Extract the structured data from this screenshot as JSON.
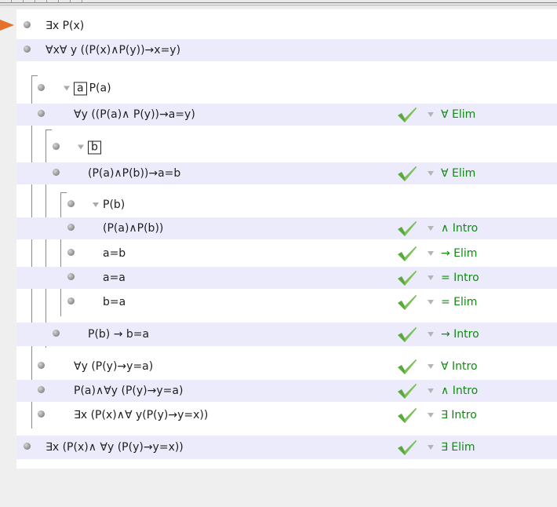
{
  "proof": {
    "premises": [
      "∃x P(x)",
      "∀x∀ y ((P(x)∧P(y))→x=y)"
    ],
    "outer_box": {
      "var": "a",
      "assumption": "P(a)",
      "step1": {
        "formula": "∀y ((P(a)∧ P(y))→a=y)",
        "rule": "∀ Elim"
      },
      "inner_box": {
        "var": "b",
        "step1": {
          "formula": "(P(a)∧P(b))→a=b",
          "rule": "∀ Elim"
        },
        "sub_box": {
          "assumption": "P(b)",
          "lines": [
            {
              "formula": "(P(a)∧P(b))",
              "rule": "∧ Intro"
            },
            {
              "formula": "a=b",
              "rule": "→ Elim"
            },
            {
              "formula": "a=a",
              "rule": "= Intro"
            },
            {
              "formula": "b=a",
              "rule": "= Elim"
            }
          ]
        },
        "conclusion": {
          "formula": "P(b) → b=a",
          "rule": "→ Intro"
        }
      },
      "after": [
        {
          "formula": "∀y (P(y)→y=a)",
          "rule": "∀ Intro"
        },
        {
          "formula": "P(a)∧∀y (P(y)→y=a)",
          "rule": "∧ Intro"
        },
        {
          "formula": "∃x (P(x)∧∀ y(P(y)→y=x))",
          "rule": "∃ Intro"
        }
      ]
    },
    "final": {
      "formula": "∃x (P(x)∧ ∀y (P(y)→y=x))",
      "rule": "∃ Elim"
    }
  },
  "colors": {
    "rule_text": "#128a12",
    "check": "#5aaa3a",
    "alt_row": "#ebebfb",
    "pointer": "#e3732c"
  }
}
